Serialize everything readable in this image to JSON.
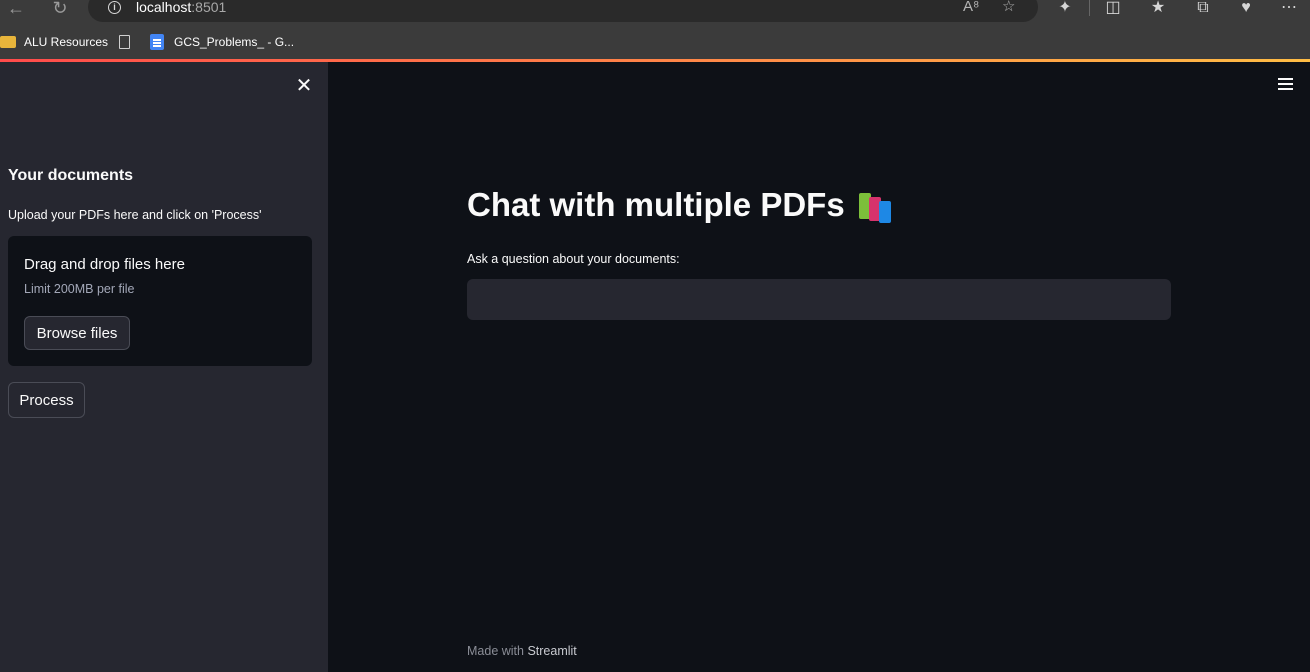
{
  "browser": {
    "url_host": "localhost",
    "url_port": ":8501",
    "bookmarks": [
      {
        "label": "ALU Resources",
        "icon": "folder-icon"
      },
      {
        "label": "",
        "icon": "page-icon"
      },
      {
        "label": "GCS_Problems_ - G...",
        "icon": "doc-icon"
      }
    ]
  },
  "sidebar": {
    "heading": "Your documents",
    "caption": "Upload your PDFs here and click on 'Process'",
    "uploader": {
      "title": "Drag and drop files here",
      "limit": "Limit 200MB per file",
      "browse_label": "Browse files"
    },
    "process_label": "Process"
  },
  "main": {
    "title": "Chat with multiple PDFs",
    "title_icon": "books-icon",
    "question_label": "Ask a question about your documents:",
    "question_value": ""
  },
  "footer": {
    "prefix": "Made with ",
    "brand": "Streamlit"
  },
  "colors": {
    "background": "#0e1117",
    "sidebar": "#262730",
    "text": "#fafafa",
    "accent_start": "#ff4b4b",
    "accent_end": "#ffbd45"
  }
}
